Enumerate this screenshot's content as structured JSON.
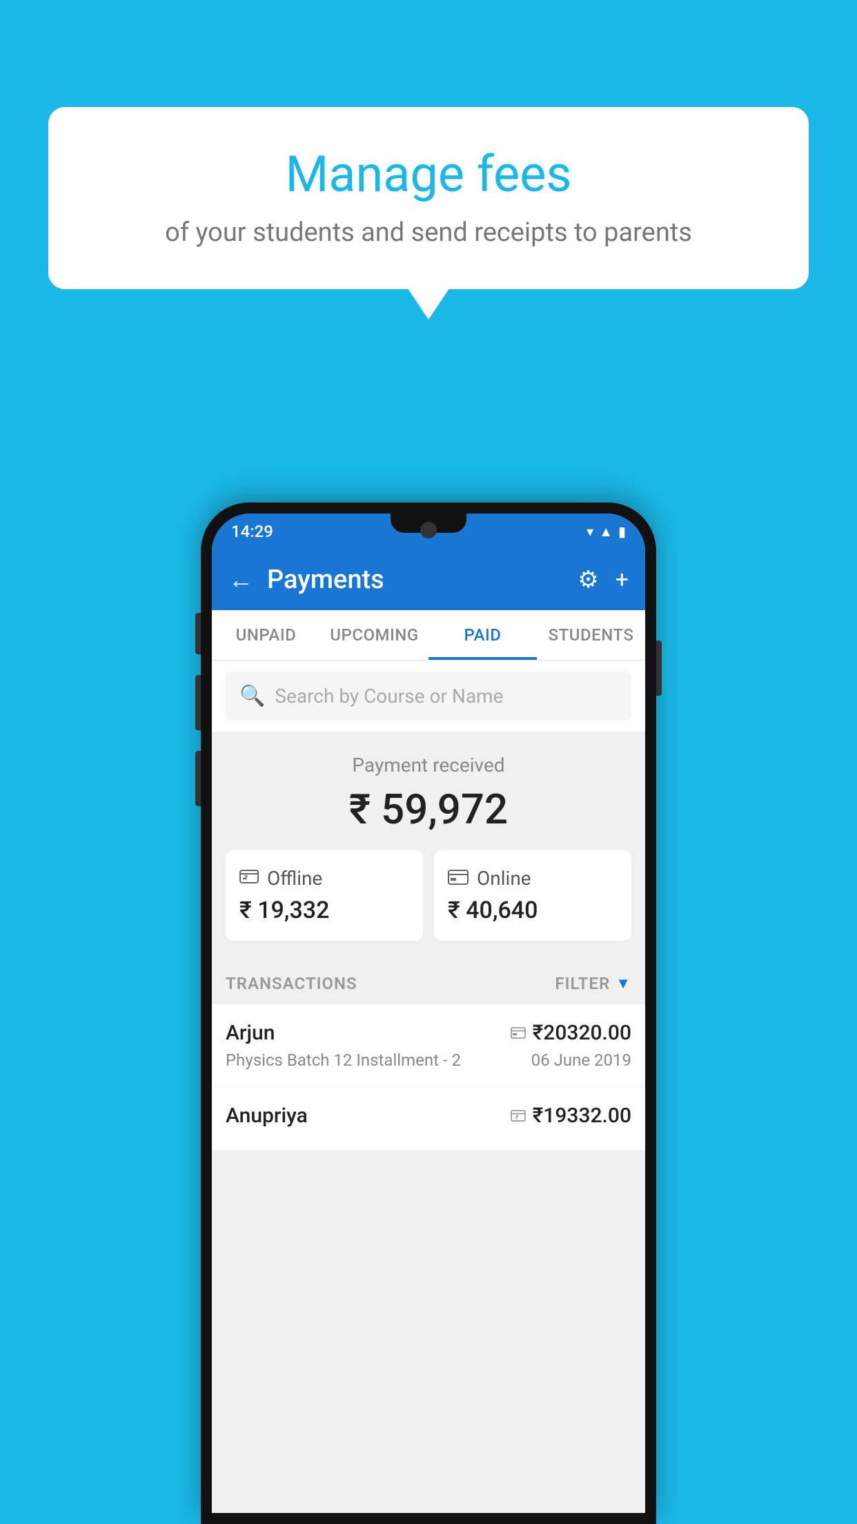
{
  "background_color": "#1ab8e8",
  "speech_bubble": {
    "title": "Manage fees",
    "subtitle": "of your students and send receipts to parents"
  },
  "status_bar": {
    "time": "14:29",
    "icons": [
      "wifi",
      "signal",
      "battery"
    ]
  },
  "app_bar": {
    "title": "Payments",
    "back_label": "←",
    "settings_label": "⚙",
    "add_label": "+"
  },
  "tabs": [
    {
      "label": "UNPAID",
      "active": false
    },
    {
      "label": "UPCOMING",
      "active": false
    },
    {
      "label": "PAID",
      "active": true
    },
    {
      "label": "STUDENTS",
      "active": false
    }
  ],
  "search": {
    "placeholder": "Search by Course or Name"
  },
  "payment_received": {
    "label": "Payment received",
    "amount": "₹ 59,972",
    "offline": {
      "label": "Offline",
      "amount": "₹ 19,332"
    },
    "online": {
      "label": "Online",
      "amount": "₹ 40,640"
    }
  },
  "transactions": {
    "header": "TRANSACTIONS",
    "filter_label": "FILTER",
    "rows": [
      {
        "name": "Arjun",
        "amount": "₹20320.00",
        "payment_type": "online",
        "course": "Physics Batch 12 Installment - 2",
        "date": "06 June 2019"
      },
      {
        "name": "Anupriya",
        "amount": "₹19332.00",
        "payment_type": "offline",
        "course": "",
        "date": ""
      }
    ]
  }
}
